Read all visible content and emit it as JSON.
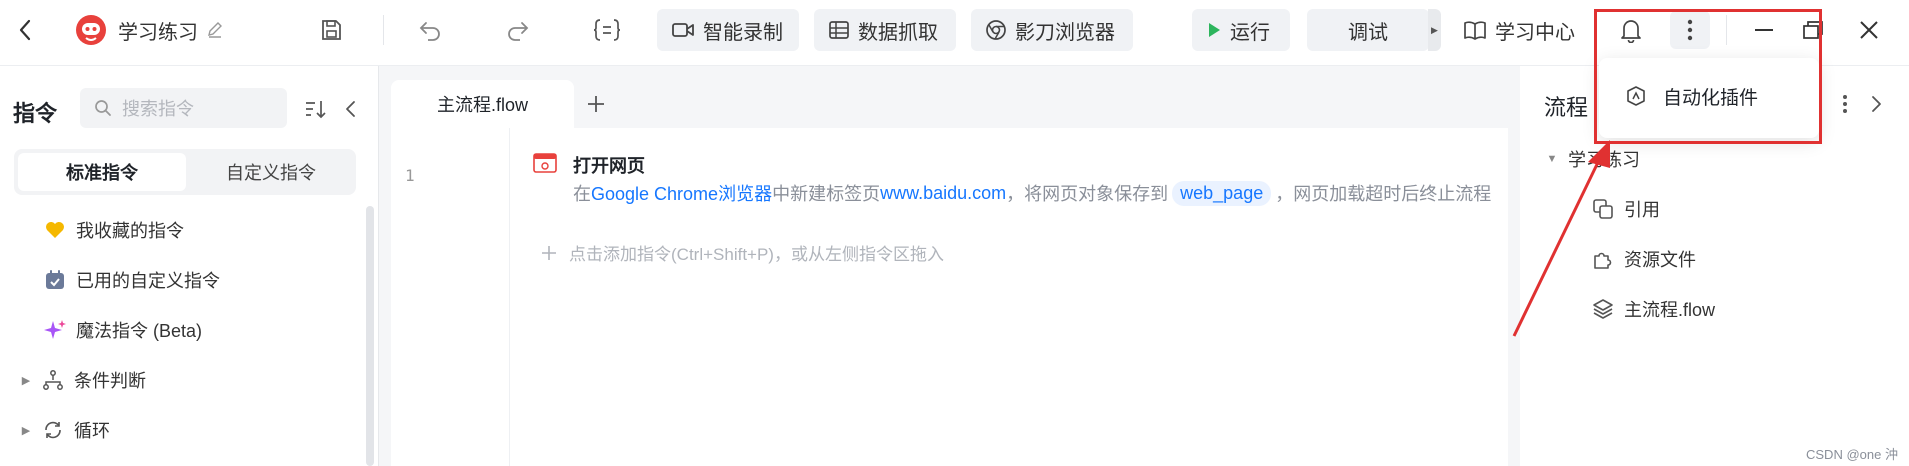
{
  "toolbar": {
    "project_name": "学习练习",
    "buttons": {
      "smart_record": "智能录制",
      "data_capture": "数据抓取",
      "browser": "影刀浏览器",
      "run": "运行",
      "debug": "调试",
      "learn_center": "学习中心"
    }
  },
  "left_panel": {
    "title": "指令",
    "search_placeholder": "搜索指令",
    "tabs": [
      "标准指令",
      "自定义指令"
    ],
    "items": [
      {
        "label": "我收藏的指令"
      },
      {
        "label": "已用的自定义指令"
      },
      {
        "label": "魔法指令 (Beta)"
      },
      {
        "label": "条件判断"
      },
      {
        "label": "循环"
      }
    ]
  },
  "editor": {
    "tab_label": "主流程.flow",
    "line_number": "1",
    "step": {
      "title": "打开网页",
      "desc": {
        "p1": "在",
        "browser": "Google Chrome浏览器",
        "p2": "中新建标签页",
        "url": "www.baidu.com",
        "p3": "，将网页对象保存到",
        "var": "web_page",
        "p4": "，网页加载超时后终止流程"
      }
    },
    "add_hint": "点击添加指令(Ctrl+Shift+P)，或从左侧指令区拖入"
  },
  "right_panel": {
    "title": "流程",
    "tree_root": "学习练习",
    "tree_items": [
      {
        "label": "引用"
      },
      {
        "label": "资源文件"
      },
      {
        "label": "主流程.flow"
      }
    ]
  },
  "popup": {
    "item_label": "自动化插件"
  },
  "watermark": "CSDN @one 沖",
  "colors": {
    "accent_blue": "#1677ff",
    "run_green": "#2db55d",
    "highlight_red": "#e03131"
  }
}
